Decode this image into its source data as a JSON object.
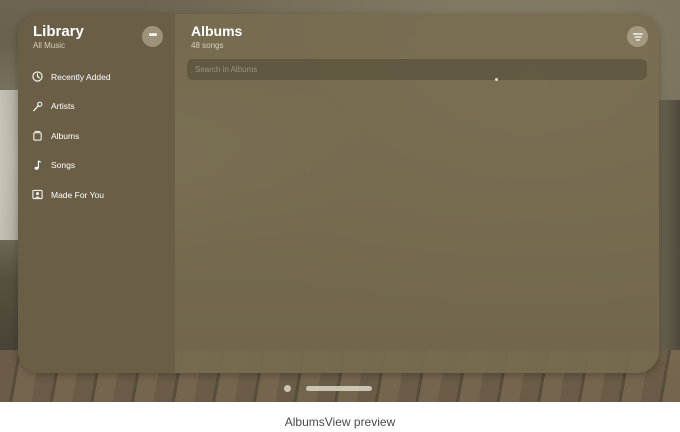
{
  "sidebar": {
    "title": "Library",
    "subtitle": "All Music",
    "more_icon": "ellipsis-icon",
    "items": [
      {
        "label": "Recently Added",
        "icon": "clock-icon"
      },
      {
        "label": "Artists",
        "icon": "microphone-icon"
      },
      {
        "label": "Albums",
        "icon": "album-icon"
      },
      {
        "label": "Songs",
        "icon": "music-note-icon"
      },
      {
        "label": "Made For You",
        "icon": "person-square-icon"
      }
    ]
  },
  "main": {
    "title": "Albums",
    "subtitle": "48 songs",
    "filter_icon": "filter-icon",
    "search_placeholder": "Search in Albums"
  },
  "caption": "AlbumsView preview"
}
